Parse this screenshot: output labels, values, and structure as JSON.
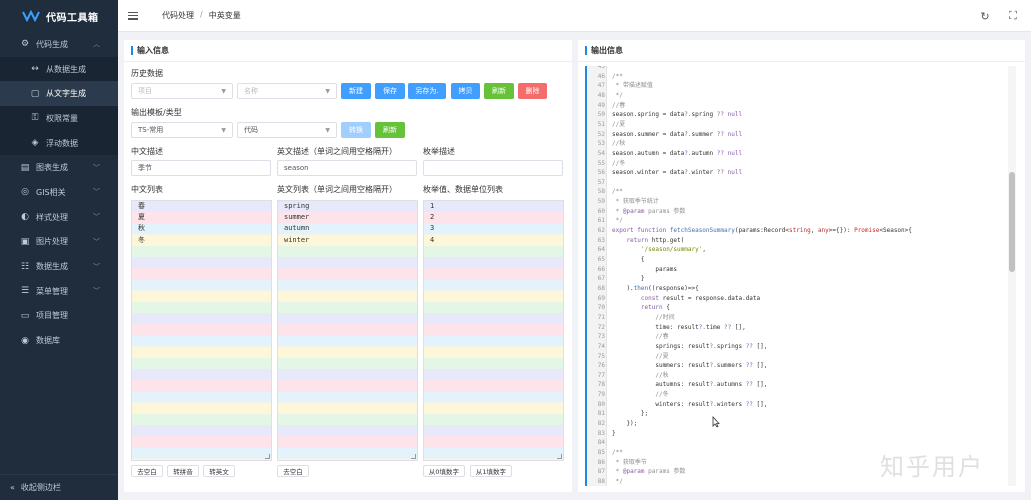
{
  "app": {
    "title": "代码工具箱"
  },
  "sidebar": {
    "items": [
      {
        "label": "代码生成",
        "icon": "gear-icon",
        "expanded": true
      },
      {
        "label": "图表生成",
        "icon": "chart-icon"
      },
      {
        "label": "GIS相关",
        "icon": "globe-icon"
      },
      {
        "label": "样式处理",
        "icon": "palette-icon"
      },
      {
        "label": "图片处理",
        "icon": "image-icon"
      },
      {
        "label": "数据生成",
        "icon": "data-icon"
      },
      {
        "label": "菜单管理",
        "icon": "menu-icon"
      },
      {
        "label": "项目管理",
        "icon": "project-icon"
      },
      {
        "label": "数据库",
        "icon": "database-icon"
      }
    ],
    "sub_items": [
      {
        "label": "从数据生成",
        "icon": "arrow-icon"
      },
      {
        "label": "从文字生成",
        "icon": "text-icon",
        "active": true
      },
      {
        "label": "权限常量",
        "icon": "key-icon"
      },
      {
        "label": "浮动数据",
        "icon": "float-icon"
      }
    ],
    "collapse_label": "收起侧边栏"
  },
  "header": {
    "breadcrumb": [
      "代码处理",
      "中英变量"
    ]
  },
  "input_panel": {
    "title": "输入信息",
    "history_label": "历史数据",
    "project_placeholder": "项目",
    "name_placeholder": "名称",
    "buttons": {
      "new": "新建",
      "save": "保存",
      "save_as": "另存为.",
      "copy": "拷贝",
      "refresh": "刷新",
      "delete": "删除"
    },
    "template_label": "输出模板/类型",
    "template_type": "TS-常用",
    "template_name": "代码",
    "convert_label": "转换",
    "refresh2_label": "刷新",
    "cn_desc_label": "中文描述",
    "cn_desc_value": "季节",
    "en_desc_label": "英文描述（单词之间用空格隔开）",
    "en_desc_value": "season",
    "enum_desc_label": "枚举描述",
    "enum_desc_value": "",
    "cn_list_label": "中文列表",
    "en_list_label": "英文列表（单词之间用空格隔开）",
    "enum_list_label": "枚举值、数据单位列表",
    "cn_list": [
      "春",
      "夏",
      "秋",
      "冬"
    ],
    "en_list": [
      "spring",
      "summer",
      "autumn",
      "winter"
    ],
    "enum_list": [
      "1",
      "2",
      "3",
      "4"
    ],
    "cn_actions": [
      "去空白",
      "转拼音",
      "转英文"
    ],
    "en_actions": [
      "去空白"
    ],
    "enum_actions": [
      "从0填数字",
      "从1填数字"
    ]
  },
  "output_panel": {
    "title": "输出信息",
    "code_lines": [
      {
        "n": "45",
        "parts": [
          [
            "t-tx",
            ""
          ]
        ]
      },
      {
        "n": "46",
        "parts": [
          [
            "t-cm",
            "/**"
          ]
        ]
      },
      {
        "n": "47",
        "parts": [
          [
            "t-cm",
            " * 带描述赋值"
          ]
        ]
      },
      {
        "n": "48",
        "parts": [
          [
            "t-cm",
            " */"
          ]
        ]
      },
      {
        "n": "49",
        "parts": [
          [
            "t-cm",
            "//春"
          ]
        ]
      },
      {
        "n": "50",
        "parts": [
          [
            "t-tx",
            "season.spring = data"
          ],
          [
            "t-kw",
            "?."
          ],
          [
            "t-tx",
            "spring "
          ],
          [
            "t-kw",
            "?? null"
          ]
        ]
      },
      {
        "n": "51",
        "parts": [
          [
            "t-cm",
            "//夏"
          ]
        ]
      },
      {
        "n": "52",
        "parts": [
          [
            "t-tx",
            "season.summer = data"
          ],
          [
            "t-kw",
            "?."
          ],
          [
            "t-tx",
            "summer "
          ],
          [
            "t-kw",
            "?? null"
          ]
        ]
      },
      {
        "n": "53",
        "parts": [
          [
            "t-cm",
            "//秋"
          ]
        ]
      },
      {
        "n": "54",
        "parts": [
          [
            "t-tx",
            "season.autumn = data"
          ],
          [
            "t-kw",
            "?."
          ],
          [
            "t-tx",
            "autumn "
          ],
          [
            "t-kw",
            "?? null"
          ]
        ]
      },
      {
        "n": "55",
        "parts": [
          [
            "t-cm",
            "//冬"
          ]
        ]
      },
      {
        "n": "56",
        "parts": [
          [
            "t-tx",
            "season.winter = data"
          ],
          [
            "t-kw",
            "?."
          ],
          [
            "t-tx",
            "winter "
          ],
          [
            "t-kw",
            "?? null"
          ]
        ]
      },
      {
        "n": "57",
        "parts": [
          [
            "t-tx",
            ""
          ]
        ]
      },
      {
        "n": "58",
        "parts": [
          [
            "t-cm",
            "/**"
          ]
        ]
      },
      {
        "n": "59",
        "parts": [
          [
            "t-cm",
            " * 获取季节统计"
          ]
        ]
      },
      {
        "n": "60",
        "parts": [
          [
            "t-cm",
            " * "
          ],
          [
            "t-kw",
            "@param"
          ],
          [
            "t-cm",
            " params 参数"
          ]
        ]
      },
      {
        "n": "61",
        "parts": [
          [
            "t-cm",
            " */"
          ]
        ]
      },
      {
        "n": "62",
        "parts": [
          [
            "t-kw",
            "export function "
          ],
          [
            "t-fn",
            "fetchSeasonSummary"
          ],
          [
            "t-tx",
            "(params:Record<"
          ],
          [
            "t-ty",
            "string"
          ],
          [
            "t-tx",
            ", "
          ],
          [
            "t-ty",
            "any"
          ],
          [
            "t-tx",
            ">={}): "
          ],
          [
            "t-ty",
            "Promise"
          ],
          [
            "t-tx",
            "<Season>{"
          ]
        ]
      },
      {
        "n": "63",
        "parts": [
          [
            "t-tx",
            "    "
          ],
          [
            "t-kw",
            "return "
          ],
          [
            "t-tx",
            "http.get("
          ]
        ]
      },
      {
        "n": "64",
        "parts": [
          [
            "t-tx",
            "        "
          ],
          [
            "t-str",
            "'/season/summary'"
          ],
          [
            "t-tx",
            ","
          ]
        ]
      },
      {
        "n": "65",
        "parts": [
          [
            "t-tx",
            "        {"
          ]
        ]
      },
      {
        "n": "66",
        "parts": [
          [
            "t-tx",
            "            params"
          ]
        ]
      },
      {
        "n": "67",
        "parts": [
          [
            "t-tx",
            "        }"
          ]
        ]
      },
      {
        "n": "68",
        "parts": [
          [
            "t-tx",
            "    )."
          ],
          [
            "t-fn",
            "then"
          ],
          [
            "t-tx",
            "((response)=>{"
          ]
        ]
      },
      {
        "n": "69",
        "parts": [
          [
            "t-tx",
            "        "
          ],
          [
            "t-kw",
            "const "
          ],
          [
            "t-tx",
            "result = response.data.data"
          ]
        ]
      },
      {
        "n": "70",
        "parts": [
          [
            "t-tx",
            "        "
          ],
          [
            "t-kw",
            "return "
          ],
          [
            "t-tx",
            "{"
          ]
        ]
      },
      {
        "n": "71",
        "parts": [
          [
            "t-tx",
            "            "
          ],
          [
            "t-cm",
            "//时间"
          ]
        ]
      },
      {
        "n": "72",
        "parts": [
          [
            "t-tx",
            "            time: result"
          ],
          [
            "t-kw",
            "?."
          ],
          [
            "t-tx",
            "time "
          ],
          [
            "t-kw",
            "?? "
          ],
          [
            "t-tx",
            "[],"
          ]
        ]
      },
      {
        "n": "73",
        "parts": [
          [
            "t-tx",
            "            "
          ],
          [
            "t-cm",
            "//春"
          ]
        ]
      },
      {
        "n": "74",
        "parts": [
          [
            "t-tx",
            "            springs: result"
          ],
          [
            "t-kw",
            "?."
          ],
          [
            "t-tx",
            "springs "
          ],
          [
            "t-kw",
            "?? "
          ],
          [
            "t-tx",
            "[],"
          ]
        ]
      },
      {
        "n": "75",
        "parts": [
          [
            "t-tx",
            "            "
          ],
          [
            "t-cm",
            "//夏"
          ]
        ]
      },
      {
        "n": "76",
        "parts": [
          [
            "t-tx",
            "            summers: result"
          ],
          [
            "t-kw",
            "?."
          ],
          [
            "t-tx",
            "summers "
          ],
          [
            "t-kw",
            "?? "
          ],
          [
            "t-tx",
            "[],"
          ]
        ]
      },
      {
        "n": "77",
        "parts": [
          [
            "t-tx",
            "            "
          ],
          [
            "t-cm",
            "//秋"
          ]
        ]
      },
      {
        "n": "78",
        "parts": [
          [
            "t-tx",
            "            autumns: result"
          ],
          [
            "t-kw",
            "?."
          ],
          [
            "t-tx",
            "autumns "
          ],
          [
            "t-kw",
            "?? "
          ],
          [
            "t-tx",
            "[],"
          ]
        ]
      },
      {
        "n": "79",
        "parts": [
          [
            "t-tx",
            "            "
          ],
          [
            "t-cm",
            "//冬"
          ]
        ]
      },
      {
        "n": "80",
        "parts": [
          [
            "t-tx",
            "            winters: result"
          ],
          [
            "t-kw",
            "?."
          ],
          [
            "t-tx",
            "winters "
          ],
          [
            "t-kw",
            "?? "
          ],
          [
            "t-tx",
            "[],"
          ]
        ]
      },
      {
        "n": "81",
        "parts": [
          [
            "t-tx",
            "        };"
          ]
        ]
      },
      {
        "n": "82",
        "parts": [
          [
            "t-tx",
            "    });"
          ]
        ]
      },
      {
        "n": "83",
        "parts": [
          [
            "t-tx",
            "}"
          ]
        ]
      },
      {
        "n": "84",
        "parts": [
          [
            "t-tx",
            ""
          ]
        ]
      },
      {
        "n": "85",
        "parts": [
          [
            "t-cm",
            "/**"
          ]
        ]
      },
      {
        "n": "86",
        "parts": [
          [
            "t-cm",
            " * 获取季节"
          ]
        ]
      },
      {
        "n": "87",
        "parts": [
          [
            "t-cm",
            " * "
          ],
          [
            "t-kw",
            "@param"
          ],
          [
            "t-cm",
            " params 参数"
          ]
        ]
      },
      {
        "n": "88",
        "parts": [
          [
            "t-cm",
            " */"
          ]
        ]
      }
    ]
  },
  "watermark": "知乎用户"
}
